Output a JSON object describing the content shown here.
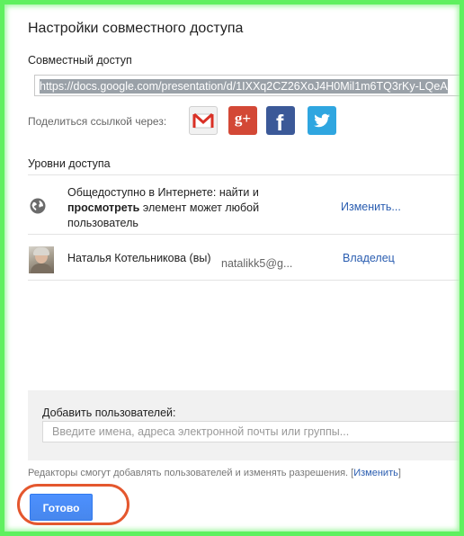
{
  "dialog": {
    "title": "Настройки совместного доступа"
  },
  "share_link": {
    "label": "Совместный доступ",
    "url": "https://docs.google.com/presentation/d/1IXXq2CZ26XoJ4H0Mil1m6TQ3rKy-LQeA"
  },
  "share_via": {
    "label": "Поделиться ссылкой через:",
    "services": [
      {
        "name": "Gmail",
        "icon": "gmail-icon",
        "color": "#f1f1f1"
      },
      {
        "name": "Google+",
        "icon": "google-plus-icon",
        "text": "g+",
        "color": "#d34836"
      },
      {
        "name": "Facebook",
        "icon": "facebook-icon",
        "text": "f",
        "color": "#3b5998"
      },
      {
        "name": "Twitter",
        "icon": "twitter-icon",
        "color": "#2fa6e0"
      }
    ]
  },
  "access": {
    "label": "Уровни доступа",
    "rows": [
      {
        "icon": "globe-icon",
        "text_part1": "Общедоступно в Интернете: найти и",
        "text_bold": "просмотреть",
        "text_part2": " элемент может любой",
        "text_part3": "пользователь",
        "action": "Изменить..."
      },
      {
        "icon": "avatar",
        "name": "Наталья Котельникова (вы)",
        "email": "natalikk5@g...",
        "role": "Владелец"
      }
    ]
  },
  "add_users": {
    "label": "Добавить пользователей:",
    "placeholder": "Введите имена, адреса электронной почты или группы..."
  },
  "footer": {
    "note_text": "Редакторы смогут добавлять пользователей и изменять разрешения. [",
    "note_link": "Изменить",
    "note_end": "]",
    "done_label": "Готово"
  },
  "colors": {
    "frame": "#5ff05f",
    "link": "#2a5db0",
    "primary_button": "#4d90fe",
    "highlight_circle": "#e4572e"
  }
}
